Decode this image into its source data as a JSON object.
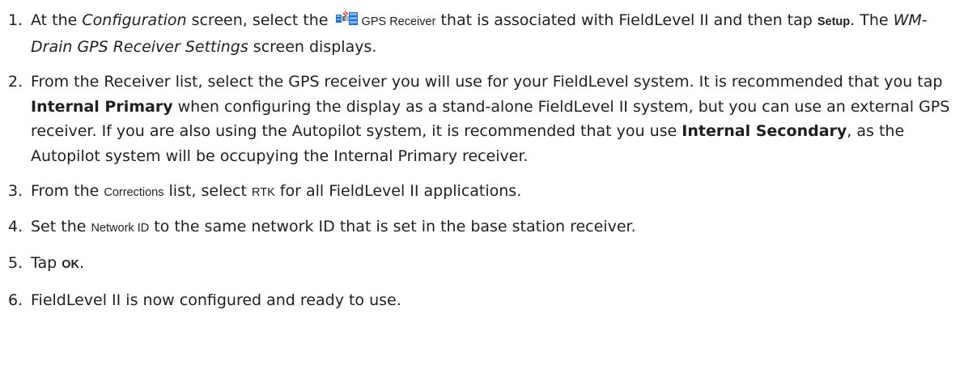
{
  "steps": [
    {
      "number": "1.",
      "t1": "At the ",
      "configuration": "Configuration",
      "t2": " screen, select the ",
      "icon": "gps-satellite-icon",
      "gps_receiver": "GPS Receiver",
      "t3": " that is associated with FieldLevel II and then tap ",
      "setup": "Setup",
      "t4": ". The ",
      "screen_name": "WM-Drain GPS Receiver Settings",
      "t5": " screen displays."
    },
    {
      "number": "2.",
      "t1": "From the Receiver list, select the GPS receiver you will use for your FieldLevel system. It is recommended that you tap ",
      "internal_primary": "Internal Primary",
      "t2": " when configuring the display as a stand-alone FieldLevel II system, but you can use an external GPS receiver. If you are also using the Autopilot system, it is recommended that you use ",
      "internal_secondary": "Internal Secondary",
      "t3": ", as the Autopilot system will be occupying the Internal Primary receiver."
    },
    {
      "number": "3.",
      "t1": "From the ",
      "corrections": "Corrections",
      "t2": " list, select ",
      "rtk": "RTK",
      "t3": " for all FieldLevel II applications."
    },
    {
      "number": "4.",
      "t1": "Set the ",
      "network_id": "Network ID",
      "t2": " to the same network ID that is set in the base station receiver."
    },
    {
      "number": "5.",
      "t1": "Tap ",
      "ok": "OK",
      "t2": "."
    },
    {
      "number": "6.",
      "t1": "FieldLevel II is now configured and ready to use."
    }
  ]
}
